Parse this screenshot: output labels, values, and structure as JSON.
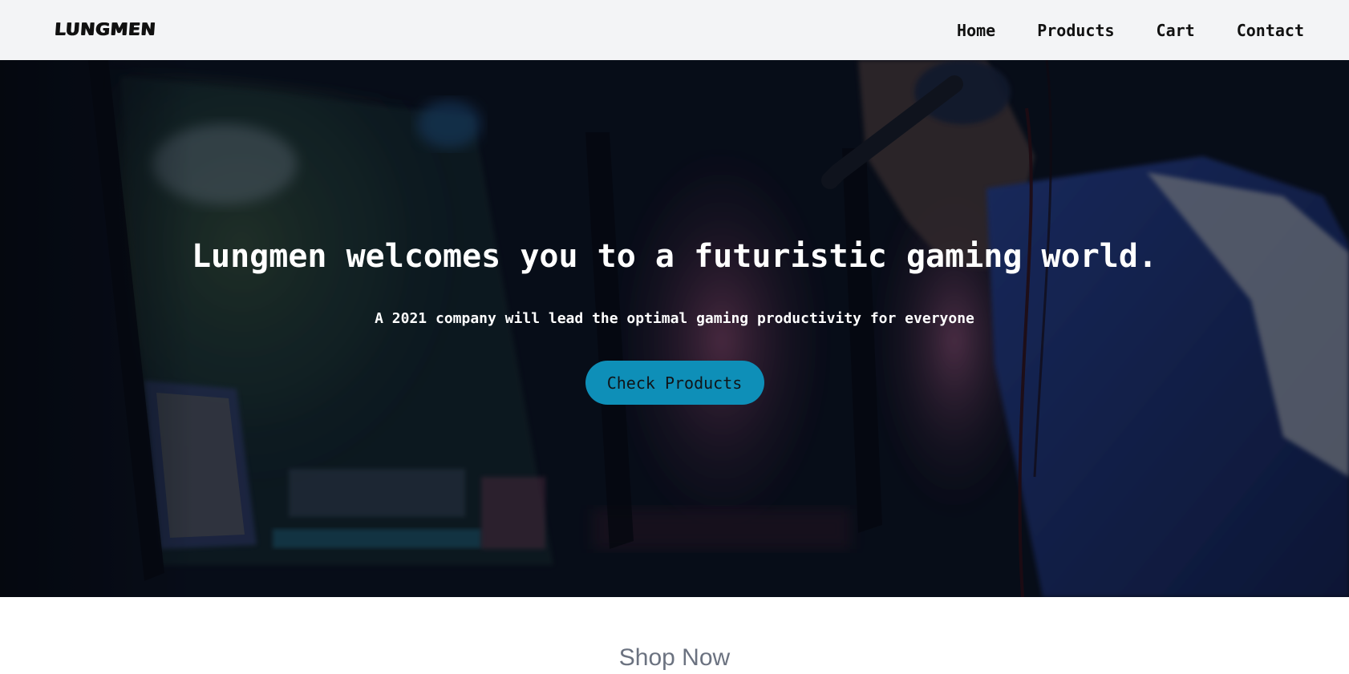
{
  "brand": {
    "logo_text": "LUNGMEN"
  },
  "nav": {
    "items": [
      {
        "label": "Home"
      },
      {
        "label": "Products"
      },
      {
        "label": "Cart"
      },
      {
        "label": "Contact"
      }
    ]
  },
  "hero": {
    "title": "Lungmen welcomes you to a futuristic gaming world.",
    "subtitle": "A 2021 company will lead the optimal gaming productivity for everyone",
    "cta_label": "Check Products",
    "background_image": "gamer-with-headset-at-monitors",
    "accent_color": "#0e8fb8"
  },
  "shop": {
    "heading": "Shop Now"
  }
}
